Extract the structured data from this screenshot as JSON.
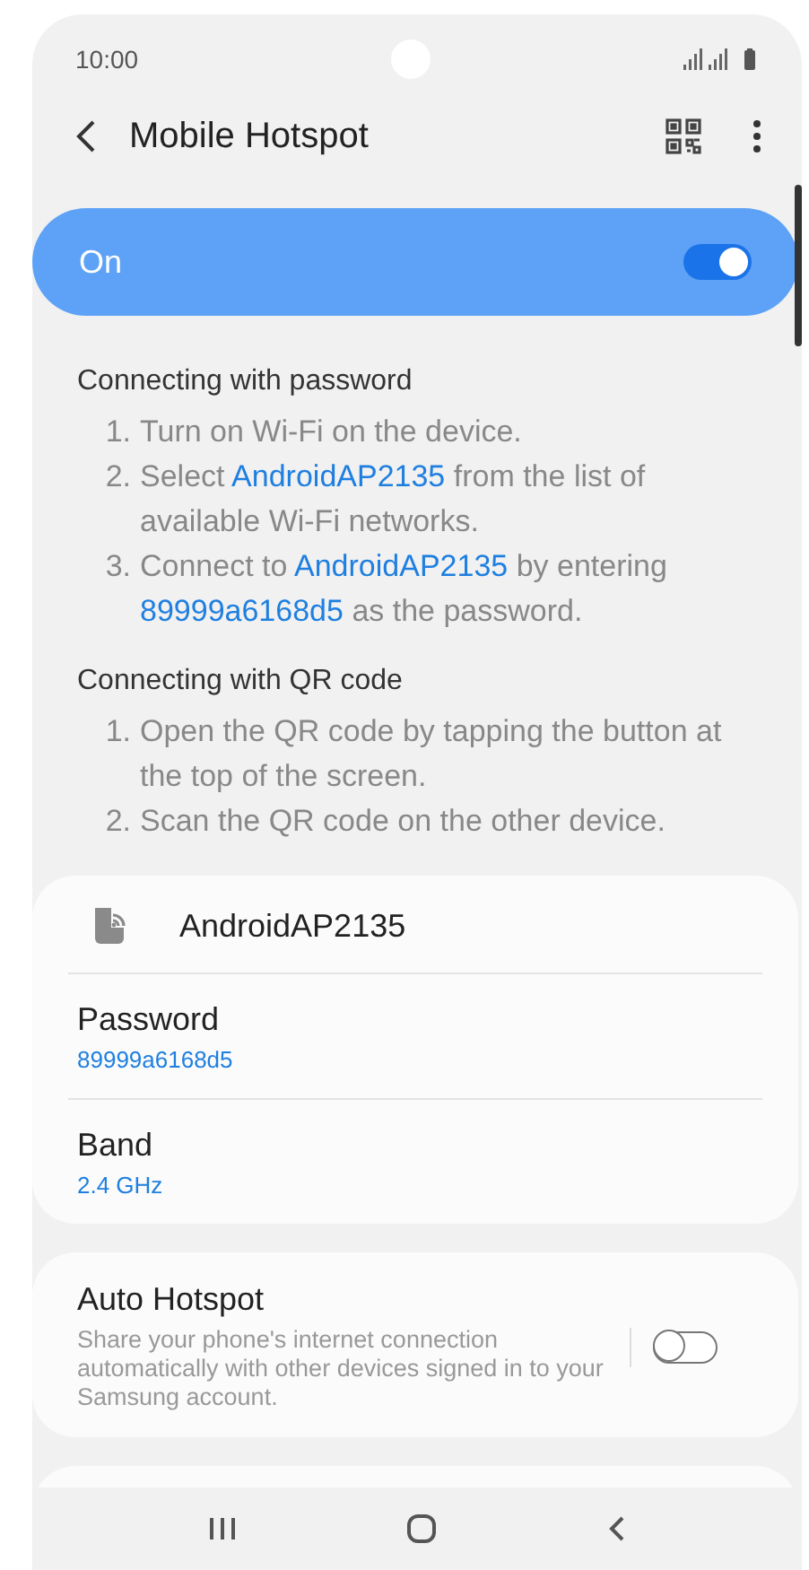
{
  "status_bar": {
    "time": "10:00"
  },
  "header": {
    "title": "Mobile Hotspot"
  },
  "master_switch": {
    "label": "On",
    "on": true
  },
  "sections": [
    {
      "title": "Connecting with password",
      "steps": [
        {
          "number": "1.",
          "parts": [
            {
              "text": "Turn on Wi-Fi on the device.",
              "highlight": false
            }
          ]
        },
        {
          "number": "2.",
          "parts": [
            {
              "text": "Select ",
              "highlight": false
            },
            {
              "text": "AndroidAP2135",
              "highlight": true
            },
            {
              "text": " from the list of available Wi-Fi networks.",
              "highlight": false
            }
          ]
        },
        {
          "number": "3.",
          "parts": [
            {
              "text": "Connect to ",
              "highlight": false
            },
            {
              "text": "AndroidAP2135",
              "highlight": true
            },
            {
              "text": " by entering ",
              "highlight": false
            },
            {
              "text": "89999a6168d5",
              "highlight": true
            },
            {
              "text": " as the password.",
              "highlight": false
            }
          ]
        }
      ]
    },
    {
      "title": "Connecting with QR code",
      "steps": [
        {
          "number": "1.",
          "parts": [
            {
              "text": "Open the QR code by tapping the button at the top of the screen.",
              "highlight": false
            }
          ]
        },
        {
          "number": "2.",
          "parts": [
            {
              "text": "Scan the QR code on the other device.",
              "highlight": false
            }
          ]
        }
      ]
    }
  ],
  "network": {
    "name": "AndroidAP2135",
    "settings": [
      {
        "label": "Password",
        "value": "89999a6168d5"
      },
      {
        "label": "Band",
        "value": "2.4 GHz"
      }
    ]
  },
  "auto_hotspot": {
    "title": "Auto Hotspot",
    "description": "Share your phone's internet connection automatically with other devices signed in to your Samsung account.",
    "on": false
  }
}
